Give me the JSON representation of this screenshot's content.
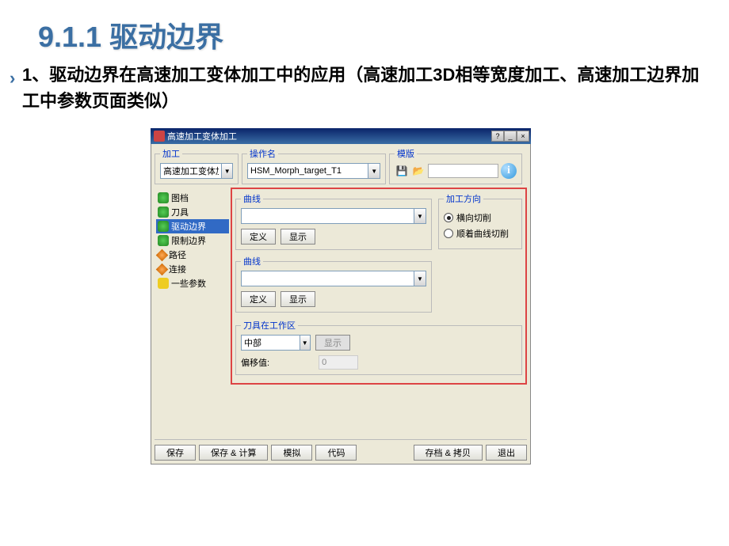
{
  "slide": {
    "title": "9.1.1 驱动边界",
    "body": "1、驱动边界在高速加工变体加工中的应用（高速加工3D相等宽度加工、高速加工边界加工中参数页面类似）"
  },
  "dialog": {
    "title": "高速加工变体加工",
    "help_tooltip": "?",
    "min": "_",
    "close": "×"
  },
  "top": {
    "jiagong_legend": "加工",
    "jiagong_value": "高速加工变体加工",
    "caozuo_legend": "操作名",
    "caozuo_value": "HSM_Morph_target_T1",
    "moban_legend": "模版",
    "save_icon": "💾",
    "open_icon": "📂",
    "info": "i"
  },
  "tree": {
    "items": [
      {
        "label": "图档",
        "icon": "green"
      },
      {
        "label": "刀具",
        "icon": "green"
      },
      {
        "label": "驱动边界",
        "icon": "green",
        "selected": true
      },
      {
        "label": "限制边界",
        "icon": "green"
      },
      {
        "label": "路径",
        "icon": "orange"
      },
      {
        "label": "连接",
        "icon": "orange"
      },
      {
        "label": "一些参数",
        "icon": "yellow"
      }
    ]
  },
  "panel": {
    "curve1_legend": "曲线",
    "curve1_define": "定义",
    "curve1_show": "显示",
    "curve2_legend": "曲线",
    "curve2_define": "定义",
    "curve2_show": "显示",
    "direction_legend": "加工方向",
    "direction_opt1": "横向切削",
    "direction_opt2": "顺着曲线切削",
    "direction_selected": 0,
    "workzone_legend": "刀具在工作区",
    "workzone_value": "中部",
    "workzone_show": "显示",
    "offset_label": "偏移值:",
    "offset_value": "0"
  },
  "bottom": {
    "save": "保存",
    "save_calc": "保存 & 计算",
    "simulate": "模拟",
    "code": "代码",
    "save_copy": "存档 & 拷贝",
    "exit": "退出"
  }
}
